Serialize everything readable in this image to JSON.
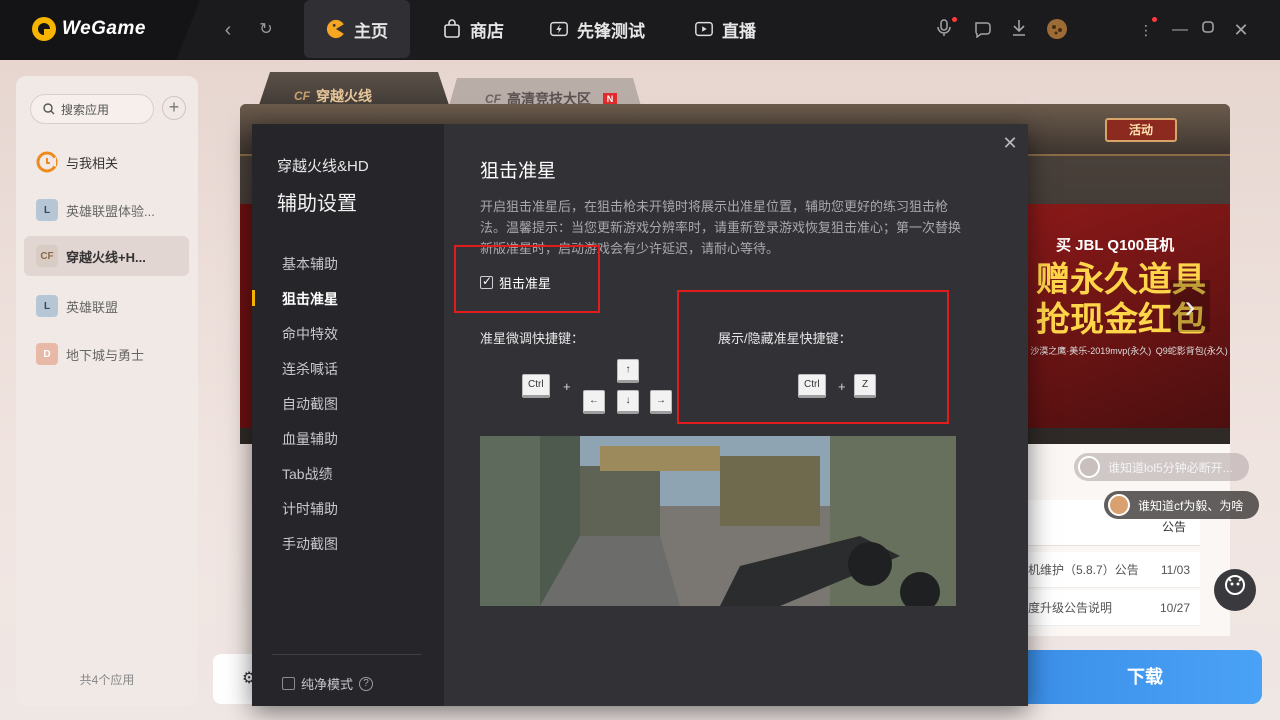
{
  "app": {
    "name": "WeGame",
    "nav": [
      {
        "label": "主页",
        "active": true
      },
      {
        "label": "商店",
        "active": false
      },
      {
        "label": "先锋测试",
        "active": false
      },
      {
        "label": "直播",
        "active": false
      }
    ]
  },
  "sidebar": {
    "search_placeholder": "搜索应用",
    "items": [
      {
        "label": "与我相关",
        "icon": "bell-icon"
      },
      {
        "label": "英雄联盟体验...",
        "icon": "lol-icon"
      },
      {
        "label": "穿越火线+H...",
        "icon": "cf-icon",
        "active": true
      },
      {
        "label": "英雄联盟",
        "icon": "lol-icon"
      },
      {
        "label": "地下城与勇士",
        "icon": "dnf-icon"
      }
    ],
    "footer": "共4个应用"
  },
  "game_tabs": [
    {
      "label": "穿越火线"
    },
    {
      "label": "高清竞技大区",
      "badge": "N"
    }
  ],
  "banner": {
    "activity": "活动",
    "promo_line1": "买 JBL Q100耳机",
    "promo_line2": "赠永久道具 抢现金红包",
    "promo_items": [
      "沙漠之鹰·美乐-2019mvp(永久)",
      "Q9蛇影背包(永久)"
    ]
  },
  "news": {
    "header": "公告",
    "rows": [
      {
        "title": "机维护（5.8.7）公告",
        "date": "11/03"
      },
      {
        "title": "度升级公告说明",
        "date": "10/27"
      }
    ]
  },
  "bubbles": [
    {
      "text": "谁知道lol5分钟必断开..."
    },
    {
      "text": "谁知道cf为毅、为啥"
    }
  ],
  "download_label": "下载",
  "modal": {
    "game_name": "穿越火线&HD",
    "heading": "辅助设置",
    "nav": [
      {
        "label": "基本辅助"
      },
      {
        "label": "狙击准星",
        "active": true
      },
      {
        "label": "命中特效"
      },
      {
        "label": "连杀喊话"
      },
      {
        "label": "自动截图"
      },
      {
        "label": "血量辅助"
      },
      {
        "label": "Tab战绩"
      },
      {
        "label": "计时辅助"
      },
      {
        "label": "手动截图"
      }
    ],
    "pure_mode": "纯净模式",
    "content": {
      "title": "狙击准星",
      "desc": "开启狙击准星后，在狙击枪未开镜时将展示出准星位置，辅助您更好的练习狙击枪法。温馨提示：当您更新游戏分辨率时，请重新登录游戏恢复狙击准心；第一次替换新版准星时，启动游戏会有少许延迟，请耐心等待。",
      "checkbox_label": "狙击准星",
      "checkbox_checked": true,
      "fine_tune_label": "准星微调快捷键：",
      "toggle_label": "展示/隐藏准星快捷键：",
      "keys": {
        "ctrl": "Ctrl",
        "plus": "+",
        "up": "↑",
        "left": "←",
        "down": "↓",
        "right": "→",
        "z": "Z"
      }
    }
  }
}
